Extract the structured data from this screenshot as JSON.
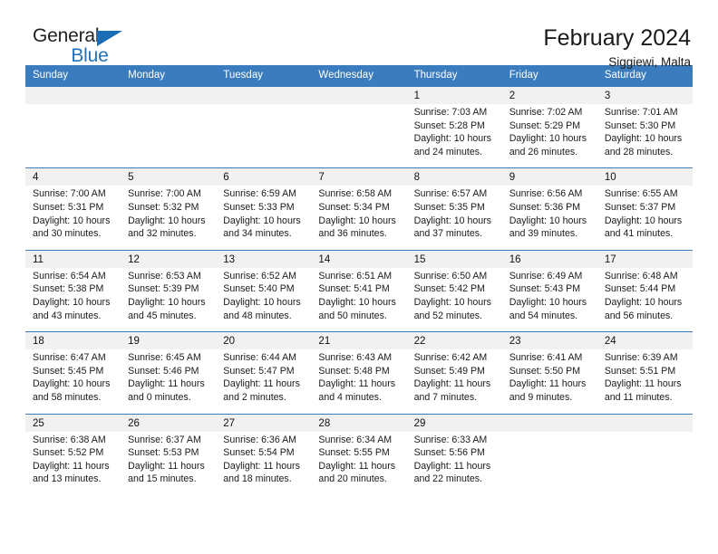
{
  "brand": {
    "name_part1": "General",
    "name_part2": "Blue",
    "accent_color": "#1a6cb5"
  },
  "header": {
    "title": "February 2024",
    "subtitle": "Siggiewi, Malta"
  },
  "theme": {
    "header_blue": "#3a7cbe",
    "daynum_background": "#f1f1f1"
  },
  "calendar": {
    "weekday_headers": [
      "Sunday",
      "Monday",
      "Tuesday",
      "Wednesday",
      "Thursday",
      "Friday",
      "Saturday"
    ],
    "weeks": [
      [
        null,
        null,
        null,
        null,
        {
          "day": "1",
          "sunrise": "Sunrise: 7:03 AM",
          "sunset": "Sunset: 5:28 PM",
          "daylight": "Daylight: 10 hours and 24 minutes."
        },
        {
          "day": "2",
          "sunrise": "Sunrise: 7:02 AM",
          "sunset": "Sunset: 5:29 PM",
          "daylight": "Daylight: 10 hours and 26 minutes."
        },
        {
          "day": "3",
          "sunrise": "Sunrise: 7:01 AM",
          "sunset": "Sunset: 5:30 PM",
          "daylight": "Daylight: 10 hours and 28 minutes."
        }
      ],
      [
        {
          "day": "4",
          "sunrise": "Sunrise: 7:00 AM",
          "sunset": "Sunset: 5:31 PM",
          "daylight": "Daylight: 10 hours and 30 minutes."
        },
        {
          "day": "5",
          "sunrise": "Sunrise: 7:00 AM",
          "sunset": "Sunset: 5:32 PM",
          "daylight": "Daylight: 10 hours and 32 minutes."
        },
        {
          "day": "6",
          "sunrise": "Sunrise: 6:59 AM",
          "sunset": "Sunset: 5:33 PM",
          "daylight": "Daylight: 10 hours and 34 minutes."
        },
        {
          "day": "7",
          "sunrise": "Sunrise: 6:58 AM",
          "sunset": "Sunset: 5:34 PM",
          "daylight": "Daylight: 10 hours and 36 minutes."
        },
        {
          "day": "8",
          "sunrise": "Sunrise: 6:57 AM",
          "sunset": "Sunset: 5:35 PM",
          "daylight": "Daylight: 10 hours and 37 minutes."
        },
        {
          "day": "9",
          "sunrise": "Sunrise: 6:56 AM",
          "sunset": "Sunset: 5:36 PM",
          "daylight": "Daylight: 10 hours and 39 minutes."
        },
        {
          "day": "10",
          "sunrise": "Sunrise: 6:55 AM",
          "sunset": "Sunset: 5:37 PM",
          "daylight": "Daylight: 10 hours and 41 minutes."
        }
      ],
      [
        {
          "day": "11",
          "sunrise": "Sunrise: 6:54 AM",
          "sunset": "Sunset: 5:38 PM",
          "daylight": "Daylight: 10 hours and 43 minutes."
        },
        {
          "day": "12",
          "sunrise": "Sunrise: 6:53 AM",
          "sunset": "Sunset: 5:39 PM",
          "daylight": "Daylight: 10 hours and 45 minutes."
        },
        {
          "day": "13",
          "sunrise": "Sunrise: 6:52 AM",
          "sunset": "Sunset: 5:40 PM",
          "daylight": "Daylight: 10 hours and 48 minutes."
        },
        {
          "day": "14",
          "sunrise": "Sunrise: 6:51 AM",
          "sunset": "Sunset: 5:41 PM",
          "daylight": "Daylight: 10 hours and 50 minutes."
        },
        {
          "day": "15",
          "sunrise": "Sunrise: 6:50 AM",
          "sunset": "Sunset: 5:42 PM",
          "daylight": "Daylight: 10 hours and 52 minutes."
        },
        {
          "day": "16",
          "sunrise": "Sunrise: 6:49 AM",
          "sunset": "Sunset: 5:43 PM",
          "daylight": "Daylight: 10 hours and 54 minutes."
        },
        {
          "day": "17",
          "sunrise": "Sunrise: 6:48 AM",
          "sunset": "Sunset: 5:44 PM",
          "daylight": "Daylight: 10 hours and 56 minutes."
        }
      ],
      [
        {
          "day": "18",
          "sunrise": "Sunrise: 6:47 AM",
          "sunset": "Sunset: 5:45 PM",
          "daylight": "Daylight: 10 hours and 58 minutes."
        },
        {
          "day": "19",
          "sunrise": "Sunrise: 6:45 AM",
          "sunset": "Sunset: 5:46 PM",
          "daylight": "Daylight: 11 hours and 0 minutes."
        },
        {
          "day": "20",
          "sunrise": "Sunrise: 6:44 AM",
          "sunset": "Sunset: 5:47 PM",
          "daylight": "Daylight: 11 hours and 2 minutes."
        },
        {
          "day": "21",
          "sunrise": "Sunrise: 6:43 AM",
          "sunset": "Sunset: 5:48 PM",
          "daylight": "Daylight: 11 hours and 4 minutes."
        },
        {
          "day": "22",
          "sunrise": "Sunrise: 6:42 AM",
          "sunset": "Sunset: 5:49 PM",
          "daylight": "Daylight: 11 hours and 7 minutes."
        },
        {
          "day": "23",
          "sunrise": "Sunrise: 6:41 AM",
          "sunset": "Sunset: 5:50 PM",
          "daylight": "Daylight: 11 hours and 9 minutes."
        },
        {
          "day": "24",
          "sunrise": "Sunrise: 6:39 AM",
          "sunset": "Sunset: 5:51 PM",
          "daylight": "Daylight: 11 hours and 11 minutes."
        }
      ],
      [
        {
          "day": "25",
          "sunrise": "Sunrise: 6:38 AM",
          "sunset": "Sunset: 5:52 PM",
          "daylight": "Daylight: 11 hours and 13 minutes."
        },
        {
          "day": "26",
          "sunrise": "Sunrise: 6:37 AM",
          "sunset": "Sunset: 5:53 PM",
          "daylight": "Daylight: 11 hours and 15 minutes."
        },
        {
          "day": "27",
          "sunrise": "Sunrise: 6:36 AM",
          "sunset": "Sunset: 5:54 PM",
          "daylight": "Daylight: 11 hours and 18 minutes."
        },
        {
          "day": "28",
          "sunrise": "Sunrise: 6:34 AM",
          "sunset": "Sunset: 5:55 PM",
          "daylight": "Daylight: 11 hours and 20 minutes."
        },
        {
          "day": "29",
          "sunrise": "Sunrise: 6:33 AM",
          "sunset": "Sunset: 5:56 PM",
          "daylight": "Daylight: 11 hours and 22 minutes."
        },
        null,
        null
      ]
    ]
  }
}
